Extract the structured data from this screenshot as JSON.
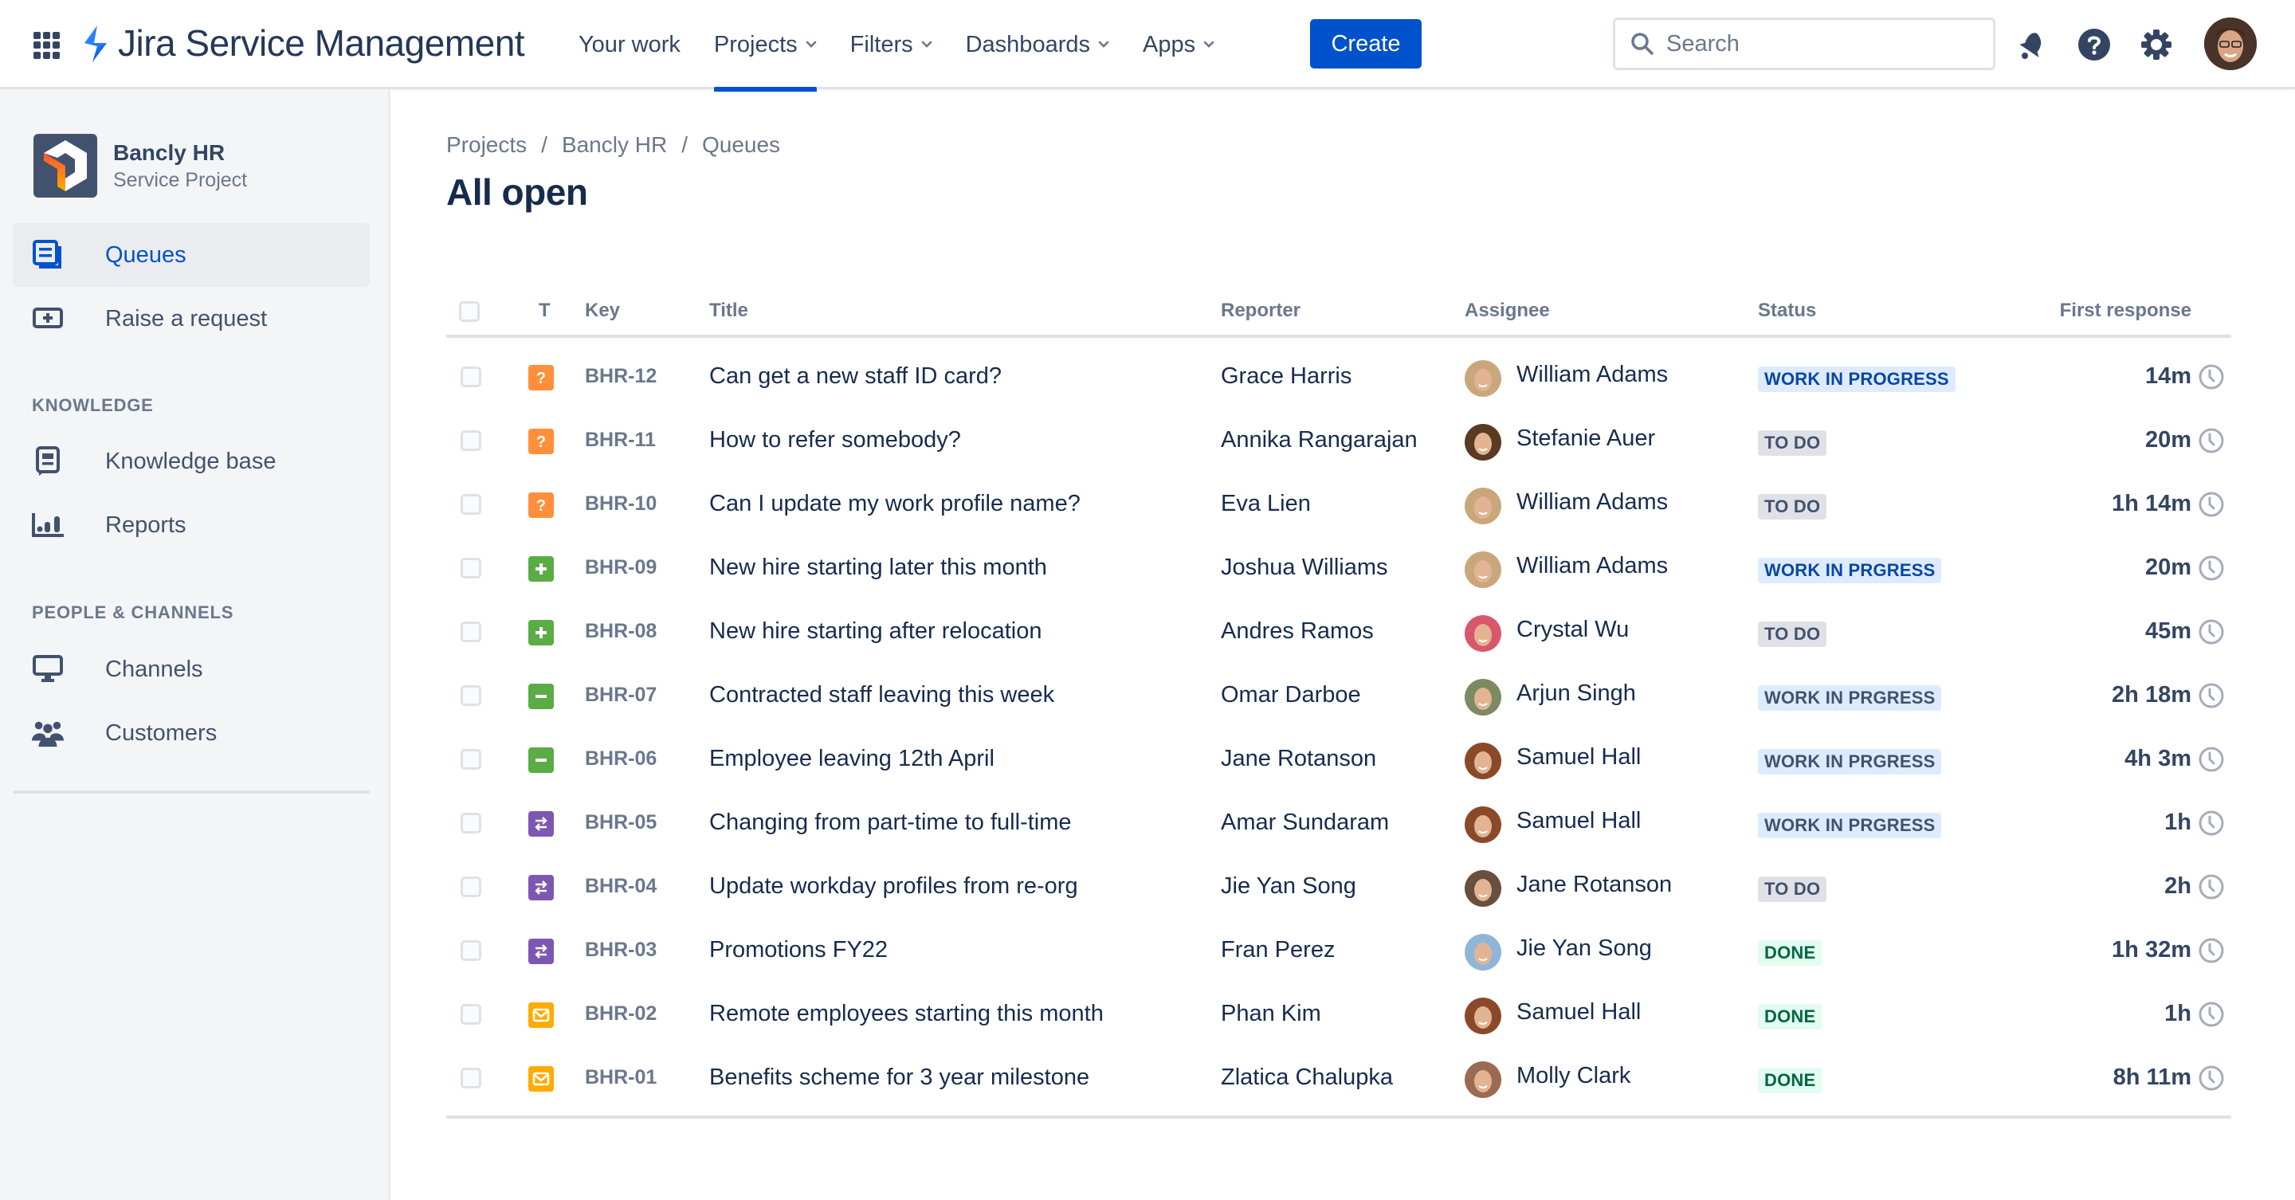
{
  "topnav": {
    "product_name": "Jira Service Management",
    "items": [
      {
        "label": "Your work",
        "has_dropdown": false,
        "active": false
      },
      {
        "label": "Projects",
        "has_dropdown": true,
        "active": true
      },
      {
        "label": "Filters",
        "has_dropdown": true,
        "active": false
      },
      {
        "label": "Dashboards",
        "has_dropdown": true,
        "active": false
      },
      {
        "label": "Apps",
        "has_dropdown": true,
        "active": false
      }
    ],
    "create_label": "Create",
    "search_placeholder": "Search",
    "icons": [
      "notifications-icon",
      "help-icon",
      "settings-icon",
      "profile-avatar"
    ]
  },
  "sidebar": {
    "project_name": "Bancly HR",
    "project_type": "Service Project",
    "items": [
      {
        "label": "Queues",
        "icon": "queues-icon",
        "active": true
      },
      {
        "label": "Raise a request",
        "icon": "raise-request-icon",
        "active": false
      }
    ],
    "sections": [
      {
        "title": "KNOWLEDGE",
        "items": [
          {
            "label": "Knowledge base",
            "icon": "knowledge-base-icon"
          },
          {
            "label": "Reports",
            "icon": "reports-icon"
          }
        ]
      },
      {
        "title": "PEOPLE & CHANNELS",
        "items": [
          {
            "label": "Channels",
            "icon": "channels-icon"
          },
          {
            "label": "Customers",
            "icon": "customers-icon"
          }
        ]
      }
    ]
  },
  "breadcrumb": [
    "Projects",
    "Bancly HR",
    "Queues"
  ],
  "page_title": "All open",
  "table": {
    "columns": [
      "T",
      "Key",
      "Title",
      "Reporter",
      "Assignee",
      "Status",
      "First response"
    ],
    "rows": [
      {
        "type": "question",
        "key": "BHR-12",
        "title": "Can get a new staff ID card?",
        "reporter": "Grace Harris",
        "assignee": "William Adams",
        "status": "WORK IN PROGRESS",
        "status_variant": "progress",
        "first_response": "14m"
      },
      {
        "type": "question",
        "key": "BHR-11",
        "title": "How to refer somebody?",
        "reporter": "Annika Rangarajan",
        "assignee": "Stefanie Auer",
        "status": "TO DO",
        "status_variant": "todo",
        "first_response": "20m"
      },
      {
        "type": "question",
        "key": "BHR-10",
        "title": "Can I update my work profile name?",
        "reporter": "Eva Lien",
        "assignee": "William Adams",
        "status": "TO DO",
        "status_variant": "todo",
        "first_response": "1h 14m"
      },
      {
        "type": "new-hire",
        "key": "BHR-09",
        "title": "New hire starting later this month",
        "reporter": "Joshua Williams",
        "assignee": "William Adams",
        "status": "WORK IN PRGRESS",
        "status_variant": "progress",
        "first_response": "20m"
      },
      {
        "type": "new-hire",
        "key": "BHR-08",
        "title": "New hire starting after relocation",
        "reporter": "Andres Ramos",
        "assignee": "Crystal Wu",
        "status": "TO DO",
        "status_variant": "todo",
        "first_response": "45m"
      },
      {
        "type": "offboarding",
        "key": "BHR-07",
        "title": "Contracted staff leaving this week",
        "reporter": "Omar Darboe",
        "assignee": "Arjun Singh",
        "status": "WORK IN PRGRESS",
        "status_variant": "progress-muted",
        "first_response": "2h 18m"
      },
      {
        "type": "offboarding",
        "key": "BHR-06",
        "title": "Employee leaving 12th April",
        "reporter": "Jane Rotanson",
        "assignee": "Samuel Hall",
        "status": "WORK IN PRGRESS",
        "status_variant": "progress-muted",
        "first_response": "4h 3m"
      },
      {
        "type": "change",
        "key": "BHR-05",
        "title": "Changing from part-time to full-time",
        "reporter": "Amar Sundaram",
        "assignee": "Samuel Hall",
        "status": "WORK IN PRGRESS",
        "status_variant": "progress-muted",
        "first_response": "1h"
      },
      {
        "type": "change",
        "key": "BHR-04",
        "title": "Update workday profiles from re-org",
        "reporter": "Jie Yan Song",
        "assignee": "Jane Rotanson",
        "status": "TO DO",
        "status_variant": "todo",
        "first_response": "2h"
      },
      {
        "type": "change",
        "key": "BHR-03",
        "title": "Promotions FY22",
        "reporter": "Fran Perez",
        "assignee": "Jie Yan Song",
        "status": "DONE",
        "status_variant": "done",
        "first_response": "1h 32m"
      },
      {
        "type": "email",
        "key": "BHR-02",
        "title": "Remote employees starting this month",
        "reporter": "Phan Kim",
        "assignee": "Samuel Hall",
        "status": "DONE",
        "status_variant": "done",
        "first_response": "1h"
      },
      {
        "type": "email",
        "key": "BHR-01",
        "title": "Benefits scheme for 3 year milestone",
        "reporter": "Zlatica Chalupka",
        "assignee": "Molly Clark",
        "status": "DONE",
        "status_variant": "done",
        "first_response": "8h 11m"
      }
    ]
  },
  "colors": {
    "brand": "#0052CC",
    "type": {
      "question": "#FF8F3A",
      "new-hire": "#5AAC44",
      "offboarding": "#5AAC44",
      "change": "#7E57B2",
      "email": "#FFAB00"
    },
    "status": {
      "progress": {
        "bg": "#DEEBFF",
        "fg": "#0747A6"
      },
      "progress-muted": {
        "bg": "#DEEBFF",
        "fg": "#42526E"
      },
      "todo": {
        "bg": "#DFE1E6",
        "fg": "#42526E"
      },
      "done": {
        "bg": "#E3FCEF",
        "fg": "#006644"
      }
    },
    "avatars": {
      "William Adams": "#C9A77A",
      "Stefanie Auer": "#5A3A22",
      "Crystal Wu": "#D9576C",
      "Arjun Singh": "#7B8A62",
      "Samuel Hall": "#8A4A2A",
      "Jane Rotanson": "#6A4E3E",
      "Jie Yan Song": "#8FB6D8",
      "Molly Clark": "#9A6A52"
    }
  }
}
